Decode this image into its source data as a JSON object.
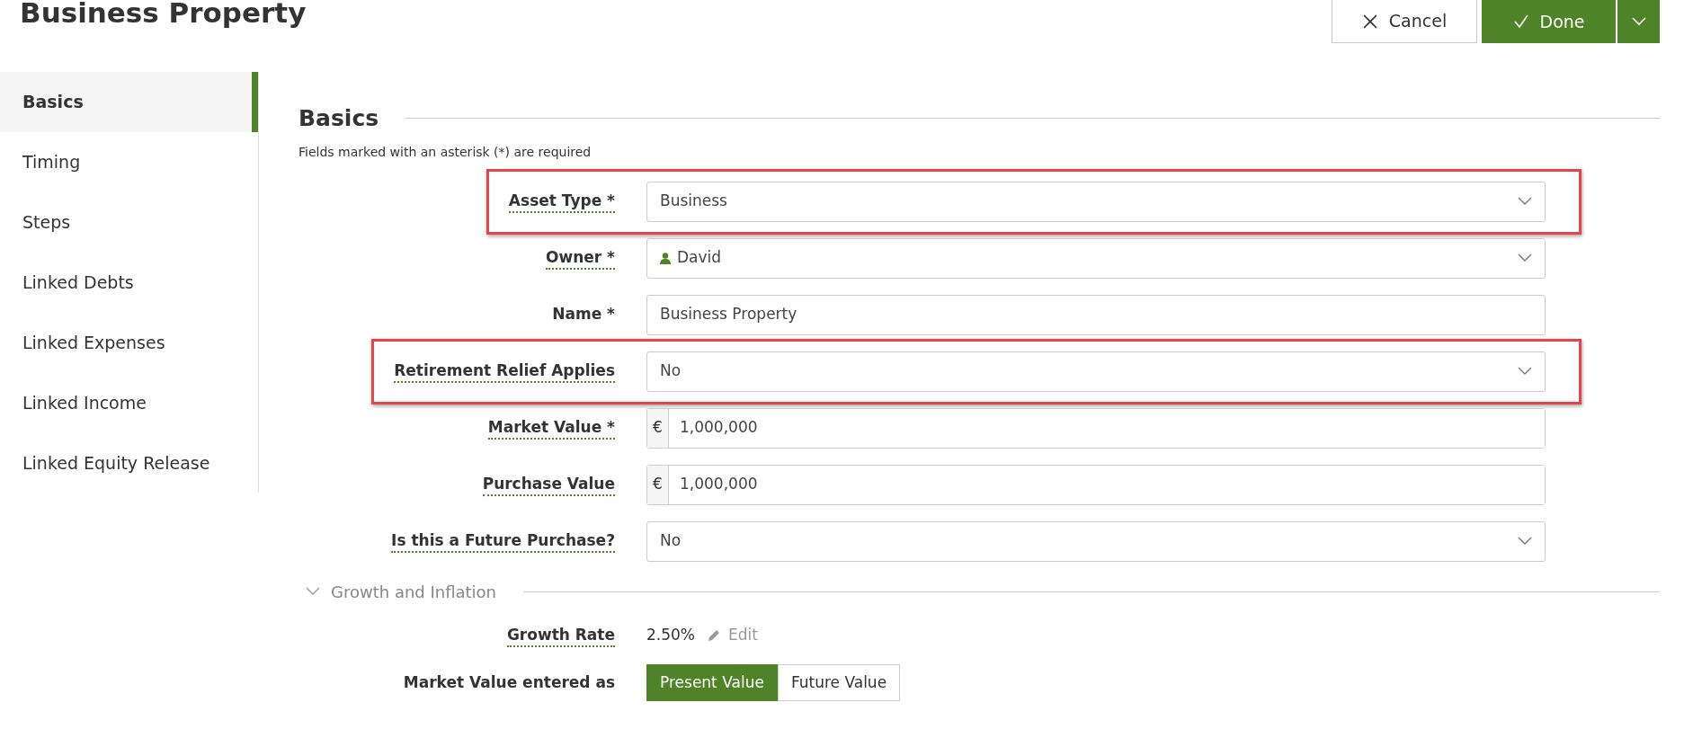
{
  "page_title": "Business Property",
  "actions": [
    {
      "kind": "cancel",
      "label": "Cancel"
    },
    {
      "kind": "done",
      "label": "Done"
    },
    {
      "kind": "menu"
    }
  ],
  "sidebar": {
    "items": [
      {
        "label": "Basics",
        "selected": true
      },
      {
        "label": "Timing",
        "selected": false
      },
      {
        "label": "Steps",
        "selected": false
      },
      {
        "label": "Linked Debts",
        "selected": false
      },
      {
        "label": "Linked Expenses",
        "selected": false
      },
      {
        "label": "Linked Income",
        "selected": false
      },
      {
        "label": "Linked Equity Release",
        "selected": false
      }
    ]
  },
  "section": {
    "title": "Basics",
    "note": "Fields marked with an asterisk (*) are required"
  },
  "fields": [
    {
      "kind": "select",
      "label": "Asset Type *",
      "value": "Business",
      "has_tooltip": true,
      "highlighted": true
    },
    {
      "kind": "person",
      "label": "Owner *",
      "value": "David",
      "has_tooltip": true,
      "highlighted": false
    },
    {
      "kind": "text",
      "label": "Name *",
      "value": "Business Property",
      "has_tooltip": false,
      "highlighted": false
    },
    {
      "kind": "select",
      "label": "Retirement Relief Applies",
      "value": "No",
      "has_tooltip": true,
      "highlighted": true
    },
    {
      "kind": "currency",
      "label": "Market Value *",
      "prefix": "€",
      "value": "1,000,000",
      "has_tooltip": true,
      "highlighted": false
    },
    {
      "kind": "currency",
      "label": "Purchase Value",
      "prefix": "€",
      "value": "1,000,000",
      "has_tooltip": true,
      "highlighted": false
    },
    {
      "kind": "select",
      "label": "Is this a Future Purchase?",
      "value": "No",
      "has_tooltip": true,
      "highlighted": false
    }
  ],
  "growth": {
    "title": "Growth and Inflation",
    "expanded": true,
    "rate": {
      "label": "Growth Rate",
      "value": "2.50%",
      "edit": "Edit",
      "has_tooltip": true
    },
    "entered_as": {
      "label": "Market Value entered as",
      "options": [
        {
          "label": "Present Value",
          "selected": true
        },
        {
          "label": "Future Value",
          "selected": false
        }
      ]
    }
  }
}
